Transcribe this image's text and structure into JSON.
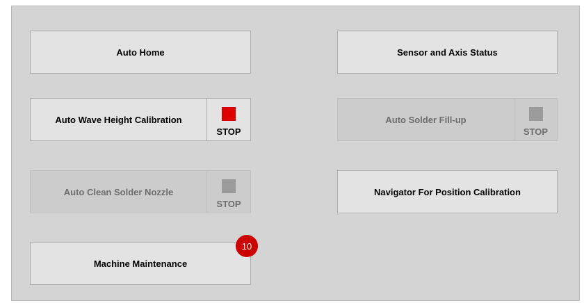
{
  "buttons": {
    "auto_home": "Auto Home",
    "sensor_status": "Sensor and Axis Status",
    "auto_wave": "Auto Wave Height Calibration",
    "auto_solder_fill": "Auto Solder Fill-up",
    "auto_clean": "Auto Clean Solder Nozzle",
    "navigator": "Navigator For Position Calibration",
    "maintenance": "Machine Maintenance"
  },
  "stop_label": "STOP",
  "maintenance_badge": "10",
  "colors": {
    "stop_active": "#dd0000",
    "stop_inactive": "#9b9b9b",
    "badge": "#cc0000"
  },
  "states": {
    "auto_wave": "enabled",
    "auto_solder_fill": "disabled",
    "auto_clean": "disabled"
  }
}
